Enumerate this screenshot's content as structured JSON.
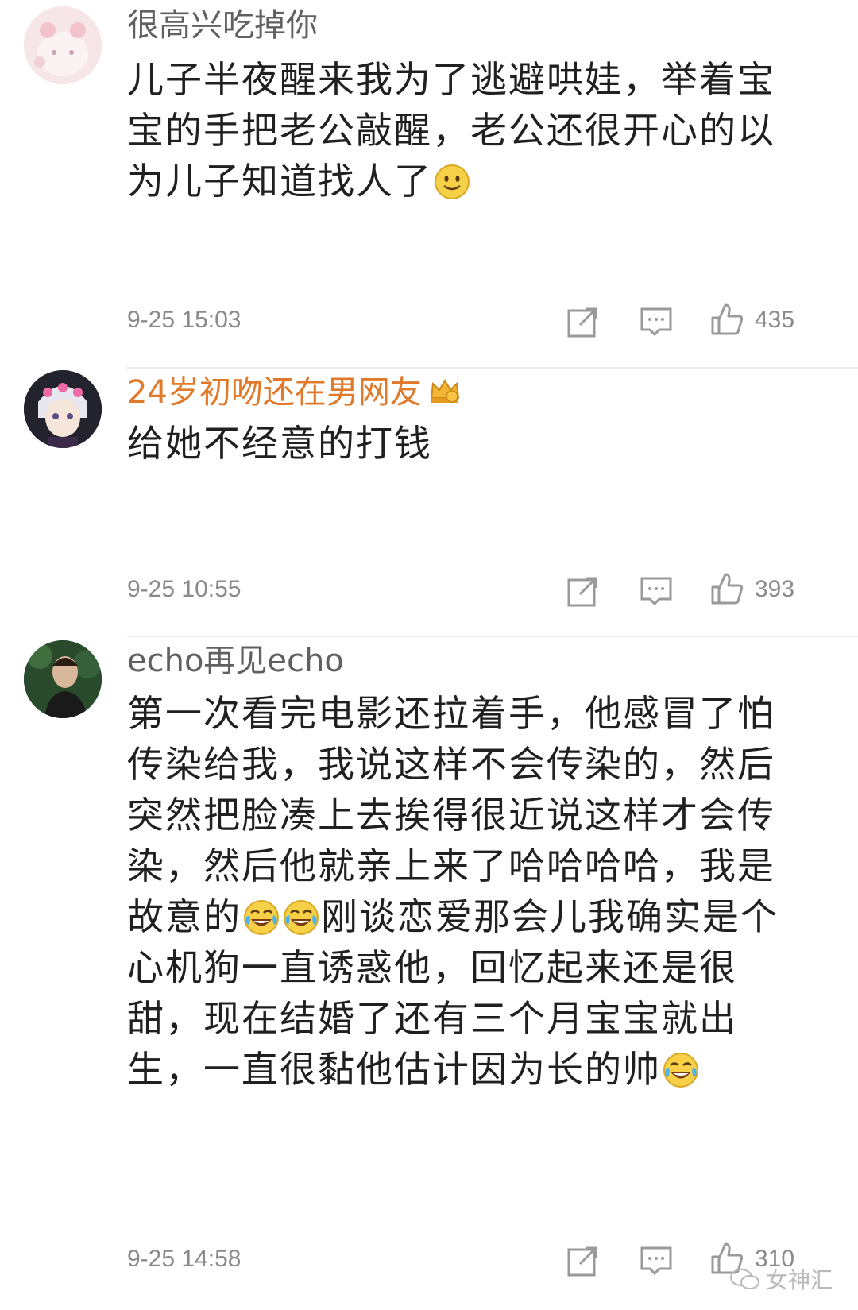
{
  "comments": [
    {
      "username": "很高兴吃掉你",
      "lines": [
        "儿子半夜醒来我为了逃避哄娃，举着宝",
        "宝的手把老公敲醒，老公还很开心的以",
        "为儿子知道找人了"
      ],
      "time": "9-25 15:03",
      "likes": "435"
    },
    {
      "username": "24岁初吻还在男网友",
      "lines": [
        "给她不经意的打钱"
      ],
      "time": "9-25 10:55",
      "likes": "393"
    },
    {
      "username": "echo再见echo",
      "lines": [
        "第一次看完电影还拉着手，他感冒了怕",
        "传染给我，我说这样不会传染的，然后",
        "突然把脸凑上去挨得很近说这样才会传",
        "染，然后他就亲上来了哈哈哈哈，我是",
        "故意的",
        "刚谈恋爱那会儿我确实是个",
        "心机狗一直诱惑他，回忆起来还是很",
        "甜，现在结婚了还有三个月宝宝就出",
        "生，一直很黏他估计因为长的帅"
      ],
      "time": "9-25 14:58",
      "likes": "310"
    }
  ],
  "watermark": "女神汇",
  "colors": {
    "vip_username": "#e07a2a",
    "meta": "#8a8a8a"
  },
  "icons": [
    "share-icon",
    "comment-icon",
    "like-icon",
    "smile-emoji",
    "laugh-cry-emoji",
    "crown-badge-icon"
  ]
}
